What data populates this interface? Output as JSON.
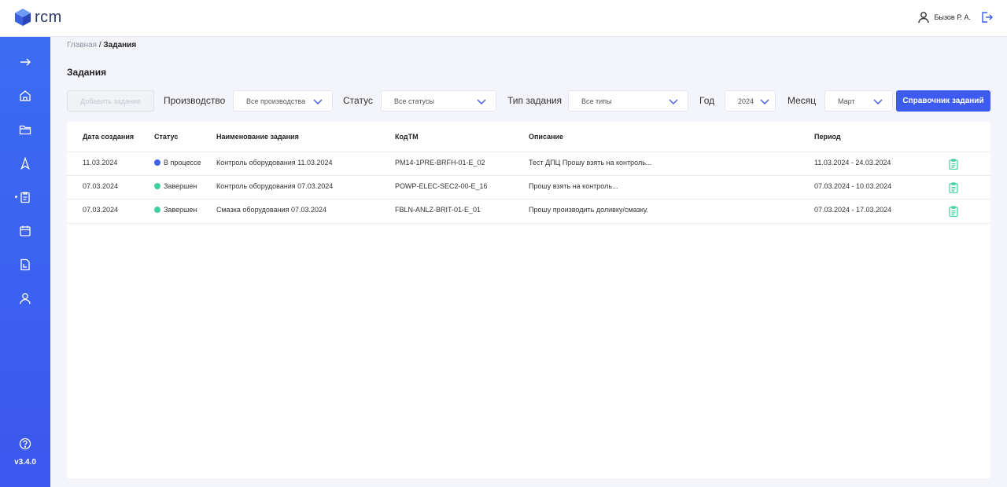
{
  "app": {
    "logo_text": "rcm",
    "version": "v3.4.0"
  },
  "header": {
    "user_name": "Бызов Р. А."
  },
  "breadcrumb": {
    "home": "Главная",
    "separator": " / ",
    "current": "Задания"
  },
  "page": {
    "title": "Задания"
  },
  "toolbar": {
    "add_button": "Добавить задание",
    "filters": [
      {
        "label": "Производство",
        "value": "Все производства"
      },
      {
        "label": "Статус",
        "value": "Все статусы"
      },
      {
        "label": "Тип задания",
        "value": "Все типы"
      },
      {
        "label": "Год",
        "value": "2024"
      },
      {
        "label": "Месяц",
        "value": "Март"
      }
    ],
    "reference_button": "Справочник заданий"
  },
  "table": {
    "columns": [
      "Дата создания",
      "Статус",
      "Наименование задания",
      "КодТМ",
      "Описание",
      "Период"
    ],
    "rows": [
      {
        "created": "11.03.2024",
        "status": "В процессе",
        "status_color": "#3d63e6",
        "name": "Контроль оборудования 11.03.2024",
        "code": "PM14-1PRE-BRFH-01-E_02",
        "description": "Тест ДПЦ Прошу взять на контроль...",
        "period": "11.03.2024 - 24.03.2024"
      },
      {
        "created": "07.03.2024",
        "status": "Завершен",
        "status_color": "#3ecfa0",
        "name": "Контроль оборудования 07.03.2024",
        "code": "POWP-ELEC-SEC2-00-E_16",
        "description": "Прошу взять на контроль...",
        "period": "07.03.2024 - 10.03.2024"
      },
      {
        "created": "07.03.2024",
        "status": "Завершен",
        "status_color": "#3ecfa0",
        "name": "Смазка оборудования 07.03.2024",
        "code": "FBLN-ANLZ-BRIT-01-E_01",
        "description": "Прошу производить доливку/смазку.",
        "period": "07.03.2024 - 17.03.2024"
      }
    ]
  },
  "icons": {
    "sidebar": [
      "arrow-right-icon",
      "home-icon",
      "folder-icon",
      "rocket-icon",
      "tasks-icon",
      "calendar-icon",
      "report-icon",
      "user-icon",
      "help-icon"
    ],
    "row_action": "clipboard-icon"
  },
  "colors": {
    "accent": "#3d5bf0",
    "sidebar": "#3c5ef0",
    "in_progress": "#3d63e6",
    "done": "#3ecfa0"
  }
}
